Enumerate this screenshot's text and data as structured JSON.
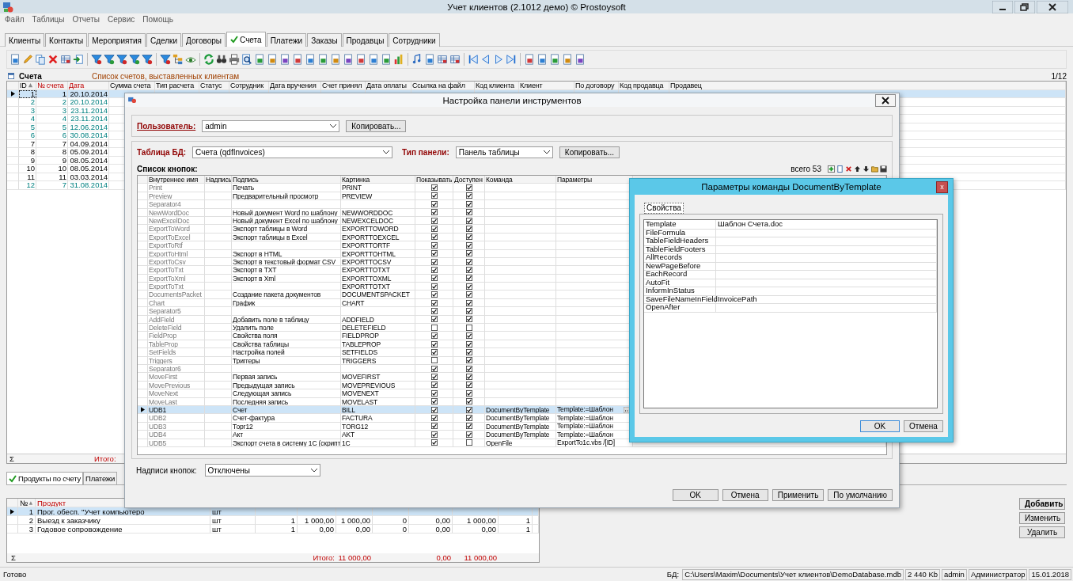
{
  "window": {
    "title": "Учет клиентов (2.1012 демо) © Prostoysoft"
  },
  "menu": [
    "Файл",
    "Таблицы",
    "Отчеты",
    "Сервис",
    "Помощь"
  ],
  "tabs": [
    {
      "label": "Клиенты",
      "selected": false
    },
    {
      "label": "Контакты",
      "selected": false
    },
    {
      "label": "Мероприятия",
      "selected": false
    },
    {
      "label": "Сделки",
      "selected": false
    },
    {
      "label": "Договоры",
      "selected": false
    },
    {
      "label": "Счета",
      "selected": true
    },
    {
      "label": "Платежи",
      "selected": false
    },
    {
      "label": "Заказы",
      "selected": false
    },
    {
      "label": "Продавцы",
      "selected": false
    },
    {
      "label": "Сотрудники",
      "selected": false
    }
  ],
  "invoices": {
    "title": "Счета",
    "subtitle": "Список счетов, выставленных клиентам",
    "counter": "1/12",
    "columns": [
      {
        "label": "ID",
        "sorted": true,
        "highlighted": false
      },
      {
        "label": "№ счета",
        "sorted": false,
        "highlighted": true
      },
      {
        "label": "Дата",
        "sorted": false,
        "highlighted": true
      },
      {
        "label": "Сумма счета",
        "sorted": false,
        "highlighted": false
      },
      {
        "label": "Тип расчета",
        "sorted": false,
        "highlighted": false
      },
      {
        "label": "Статус",
        "sorted": false,
        "highlighted": false
      },
      {
        "label": "Сотрудник",
        "sorted": false,
        "highlighted": false
      },
      {
        "label": "Дата вручения",
        "sorted": false,
        "highlighted": false
      },
      {
        "label": "Счет принял",
        "sorted": false,
        "highlighted": false
      },
      {
        "label": "Дата оплаты",
        "sorted": false,
        "highlighted": false
      },
      {
        "label": "Ссылка на файл",
        "sorted": false,
        "highlighted": false
      },
      {
        "label": "Код клиента",
        "sorted": false,
        "highlighted": false
      },
      {
        "label": "Клиент",
        "sorted": false,
        "highlighted": false
      },
      {
        "label": "По договору",
        "sorted": false,
        "highlighted": false
      },
      {
        "label": "Код продавца",
        "sorted": false,
        "highlighted": false
      },
      {
        "label": "Продавец",
        "sorted": false,
        "highlighted": false
      }
    ],
    "rows": [
      {
        "id": "1",
        "number": "1",
        "date": "20.10.2014",
        "highlighted": false,
        "selected": true
      },
      {
        "id": "2",
        "number": "2",
        "date": "20.10.2014",
        "highlighted": true,
        "selected": false
      },
      {
        "id": "3",
        "number": "3",
        "date": "23.11.2014",
        "highlighted": true,
        "selected": false
      },
      {
        "id": "4",
        "number": "4",
        "date": "23.11.2014",
        "highlighted": true,
        "selected": false
      },
      {
        "id": "5",
        "number": "5",
        "date": "12.06.2014",
        "highlighted": true,
        "selected": false
      },
      {
        "id": "6",
        "number": "6",
        "date": "30.08.2014",
        "highlighted": true,
        "selected": false
      },
      {
        "id": "7",
        "number": "7",
        "date": "04.09.2014",
        "highlighted": false,
        "selected": false
      },
      {
        "id": "8",
        "number": "8",
        "date": "05.09.2014",
        "highlighted": false,
        "selected": false
      },
      {
        "id": "9",
        "number": "9",
        "date": "08.05.2014",
        "highlighted": false,
        "selected": false
      },
      {
        "id": "10",
        "number": "10",
        "date": "08.05.2014",
        "highlighted": false,
        "selected": false
      },
      {
        "id": "11",
        "number": "11",
        "date": "03.03.2014",
        "highlighted": false,
        "selected": false
      },
      {
        "id": "12",
        "number": "7",
        "date": "31.08.2014",
        "highlighted": true,
        "selected": false
      }
    ],
    "sum_symbol": "Σ",
    "total_label": "Итого:"
  },
  "toolbar_dialog": {
    "title": "Настройка панели инструментов",
    "user_label": "Пользователь:",
    "user_value": "admin",
    "copy_button": "Копировать...",
    "table_label": "Таблица БД:",
    "table_value": "Счета (qdfInvoices)",
    "panel_label": "Тип панели:",
    "panel_value": "Панель таблицы",
    "copy_button_2": "Копировать...",
    "list_label": "Список кнопок:",
    "count": "всего 53",
    "columns": [
      "Внутреннее имя",
      "Надпись",
      "Подпись",
      "Картинка",
      "Показывать",
      "Доступен",
      "Команда",
      "Параметры"
    ],
    "rows": [
      {
        "name": "Print",
        "caption": "Печать",
        "picture": "PRINT",
        "show": true,
        "enabled": true,
        "selected": false
      },
      {
        "name": "Preview",
        "caption": "Предварительный просмотр",
        "picture": "PREVIEW",
        "show": true,
        "enabled": true,
        "selected": false
      },
      {
        "name": "Separator4",
        "show": true,
        "enabled": true,
        "selected": false
      },
      {
        "name": "NewWordDoc",
        "caption": "Новый документ Word по шаблону",
        "picture": "NEWWORDDOC",
        "show": true,
        "enabled": true,
        "selected": false
      },
      {
        "name": "NewExcelDoc",
        "caption": "Новый документ Excel по шаблону",
        "picture": "NEWEXCELDOC",
        "show": true,
        "enabled": true,
        "selected": false
      },
      {
        "name": "ExportToWord",
        "caption": "Экспорт таблицы в Word",
        "picture": "EXPORTTOWORD",
        "show": true,
        "enabled": true,
        "selected": false
      },
      {
        "name": "ExportToExcel",
        "caption": "Экспорт таблицы в Excel",
        "picture": "EXPORTTOEXCEL",
        "show": true,
        "enabled": true,
        "selected": false
      },
      {
        "name": "ExportToRtf",
        "picture": "EXPORTTORTF",
        "show": true,
        "enabled": true,
        "selected": false
      },
      {
        "name": "ExportToHtml",
        "caption": "Экспорт в HTML",
        "picture": "EXPORTTOHTML",
        "show": true,
        "enabled": true,
        "selected": false
      },
      {
        "name": "ExportToCsv",
        "caption": "Экспорт в текстовый формат CSV",
        "picture": "EXPORTTOCSV",
        "show": true,
        "enabled": true,
        "selected": false
      },
      {
        "name": "ExportToTxt",
        "caption": "Экспорт в TXT",
        "picture": "EXPORTTOTXT",
        "show": true,
        "enabled": true,
        "selected": false
      },
      {
        "name": "ExportToXml",
        "caption": "Экспорт в Xml",
        "picture": "EXPORTTOXML",
        "show": true,
        "enabled": true,
        "selected": false
      },
      {
        "name": "ExportToTxt",
        "picture": "EXPORTTOTXT",
        "show": true,
        "enabled": true,
        "selected": false
      },
      {
        "name": "DocumentsPacket",
        "caption": "Создание пакета документов",
        "picture": "DOCUMENTSPACKET",
        "show": true,
        "enabled": true,
        "selected": false
      },
      {
        "name": "Chart",
        "caption": "График",
        "picture": "CHART",
        "show": true,
        "enabled": true,
        "selected": false
      },
      {
        "name": "Separator5",
        "show": true,
        "enabled": true,
        "selected": false
      },
      {
        "name": "AddField",
        "caption": "Добавить поле в таблицу",
        "picture": "ADDFIELD",
        "show": true,
        "enabled": true,
        "selected": false
      },
      {
        "name": "DeleteField",
        "caption": "Удалить поле",
        "picture": "DELETEFIELD",
        "show": false,
        "enabled": false,
        "selected": false
      },
      {
        "name": "FieldProp",
        "caption": "Свойства поля",
        "picture": "FIELDPROP",
        "show": true,
        "enabled": true,
        "selected": false
      },
      {
        "name": "TableProp",
        "caption": "Свойства таблицы",
        "picture": "TABLEPROP",
        "show": true,
        "enabled": true,
        "selected": false
      },
      {
        "name": "SetFields",
        "caption": "Настройка полей",
        "picture": "SETFIELDS",
        "show": true,
        "enabled": true,
        "selected": false
      },
      {
        "name": "Triggers",
        "caption": "Триггеры",
        "picture": "TRIGGERS",
        "show": false,
        "enabled": true,
        "selected": false
      },
      {
        "name": "Separator6",
        "show": true,
        "enabled": true,
        "selected": false
      },
      {
        "name": "MoveFirst",
        "caption": "Первая запись",
        "picture": "MOVEFIRST",
        "show": true,
        "enabled": true,
        "selected": false
      },
      {
        "name": "MovePrevious",
        "caption": "Предыдущая запись",
        "picture": "MOVEPREVIOUS",
        "show": true,
        "enabled": true,
        "selected": false
      },
      {
        "name": "MoveNext",
        "caption": "Следующая запись",
        "picture": "MOVENEXT",
        "show": true,
        "enabled": true,
        "selected": false
      },
      {
        "name": "MoveLast",
        "caption": "Последняя запись",
        "picture": "MOVELAST",
        "show": true,
        "enabled": true,
        "selected": false
      },
      {
        "name": "UDB1",
        "caption": "Счет",
        "picture": "BILL",
        "show": true,
        "enabled": true,
        "command": "DocumentByTemplate",
        "params": "Template:=Шаблон",
        "selected": true
      },
      {
        "name": "UDB2",
        "caption": "Счет-фактура",
        "picture": "FACTURA",
        "show": true,
        "enabled": true,
        "command": "DocumentByTemplate",
        "params": "Template:=Шаблон",
        "selected": false
      },
      {
        "name": "UDB3",
        "caption": "Торг12",
        "picture": "TORG12",
        "show": true,
        "enabled": true,
        "command": "DocumentByTemplate",
        "params": "Template:=Шаблон",
        "selected": false
      },
      {
        "name": "UDB4",
        "caption": "Акт",
        "picture": "AKT",
        "show": true,
        "enabled": true,
        "command": "DocumentByTemplate",
        "params": "Template:=Шаблон",
        "selected": false
      },
      {
        "name": "UDB5",
        "caption": "Экспорт счета в систему 1С (скрипт",
        "picture": "1C",
        "show": true,
        "enabled": false,
        "command": "OpenFile",
        "params": "ExportTo1c.vbs /[ID]",
        "selected": false
      }
    ],
    "captions_label": "Надписи кнопок:",
    "captions_value": "Отключены",
    "buttons": [
      "OK",
      "Отмена",
      "Применить",
      "По умолчанию"
    ]
  },
  "command_dialog": {
    "title": "Параметры команды DocumentByTemplate",
    "close": "x",
    "tab": "Свойства",
    "properties": [
      {
        "name": "Template",
        "value": "Шаблон Счета.doc"
      },
      {
        "name": "FileFormula"
      },
      {
        "name": "TableFieldHeaders"
      },
      {
        "name": "TableFieldFooters"
      },
      {
        "name": "AllRecords"
      },
      {
        "name": "NewPageBefore"
      },
      {
        "name": "EachRecord"
      },
      {
        "name": "AutoFit"
      },
      {
        "name": "InformInStatus"
      },
      {
        "name": "SaveFileNameInField",
        "value": "InvoicePath"
      },
      {
        "name": "OpenAfter"
      }
    ],
    "buttons": [
      "OK",
      "Отмена"
    ]
  },
  "detail_tabs": [
    {
      "label": "Продукты по счету",
      "selected": true
    },
    {
      "label": "Платежи",
      "selected": false
    }
  ],
  "products": {
    "columns": [
      {
        "label": "№",
        "sorted": true,
        "highlighted": false
      },
      {
        "label": "Продукт",
        "sorted": false,
        "highlighted": true
      }
    ],
    "rows": [
      {
        "cells": [
          "1",
          "Прог. обесп. \"Учет компьютеро",
          "шт"
        ],
        "selected": true
      },
      {
        "cells": [
          "2",
          "Выезд к заказчику",
          "шт",
          "1",
          "1 000,00",
          "1 000,00",
          "0",
          "0,00",
          "1 000,00",
          "1"
        ],
        "selected": false
      },
      {
        "cells": [
          "3",
          "Годовое сопровождение",
          "шт",
          "1",
          "0,00",
          "0,00",
          "0",
          "0,00",
          "0,00",
          "1"
        ],
        "selected": false
      }
    ],
    "sum_symbol": "Σ",
    "total_label": "Итого:",
    "totals": [
      "11 000,00",
      "0,00",
      "11 000,00"
    ]
  },
  "detail_buttons": [
    "Добавить",
    "Изменить",
    "Удалить"
  ],
  "status_bar": {
    "state": "Готово",
    "db_label": "БД:",
    "path": "C:\\Users\\Maxim\\Documents\\Учет клиентов\\DemoDatabase.mdb",
    "size": "2 440 Kb",
    "user": "admin",
    "role": "Администратор",
    "date": "15.01.2018"
  }
}
